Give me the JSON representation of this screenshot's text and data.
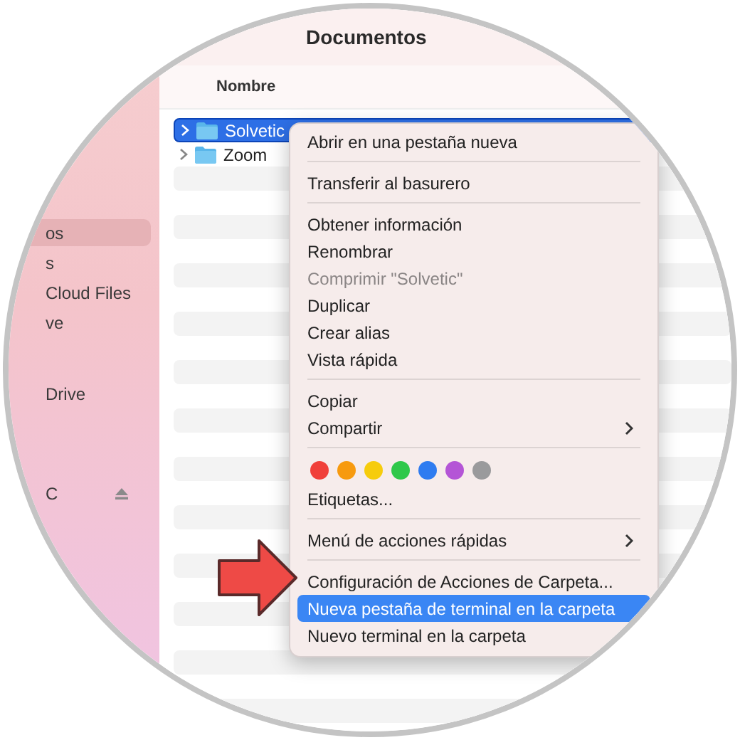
{
  "window": {
    "title": "Documentos"
  },
  "sidebar": {
    "items": [
      {
        "label": "os",
        "selected": true,
        "eject": false
      },
      {
        "label": "s",
        "selected": false,
        "eject": false
      },
      {
        "label": "Cloud Files",
        "selected": false,
        "eject": false
      },
      {
        "label": "ve",
        "selected": false,
        "eject": false
      },
      {
        "label": "Drive",
        "selected": false,
        "eject": false
      },
      {
        "label": "C",
        "selected": false,
        "eject": true
      }
    ]
  },
  "table": {
    "columns": [
      "Nombre"
    ],
    "rows": [
      {
        "name": "Solvetic",
        "selected": true
      },
      {
        "name": "Zoom",
        "selected": false
      }
    ]
  },
  "context_menu": {
    "items": [
      {
        "kind": "item",
        "label": "Abrir en una pestaña nueva",
        "disabled": false,
        "selected": false,
        "submenu": false
      },
      {
        "kind": "separator"
      },
      {
        "kind": "item",
        "label": "Transferir al basurero",
        "disabled": false,
        "selected": false,
        "submenu": false
      },
      {
        "kind": "separator"
      },
      {
        "kind": "item",
        "label": "Obtener información",
        "disabled": false,
        "selected": false,
        "submenu": false
      },
      {
        "kind": "item",
        "label": "Renombrar",
        "disabled": false,
        "selected": false,
        "submenu": false
      },
      {
        "kind": "item",
        "label": "Comprimir \"Solvetic\"",
        "disabled": true,
        "selected": false,
        "submenu": false
      },
      {
        "kind": "item",
        "label": "Duplicar",
        "disabled": false,
        "selected": false,
        "submenu": false
      },
      {
        "kind": "item",
        "label": "Crear alias",
        "disabled": false,
        "selected": false,
        "submenu": false
      },
      {
        "kind": "item",
        "label": "Vista rápida",
        "disabled": false,
        "selected": false,
        "submenu": false
      },
      {
        "kind": "separator"
      },
      {
        "kind": "item",
        "label": "Copiar",
        "disabled": false,
        "selected": false,
        "submenu": false
      },
      {
        "kind": "item",
        "label": "Compartir",
        "disabled": false,
        "selected": false,
        "submenu": true
      },
      {
        "kind": "separator"
      },
      {
        "kind": "tags",
        "colors": [
          {
            "color": "#f0403a"
          },
          {
            "color": "#f79a0e"
          },
          {
            "color": "#f6cc0c"
          },
          {
            "color": "#2fc84a"
          },
          {
            "color": "#2f7cf0"
          },
          {
            "color": "#b455d6"
          },
          {
            "color": "#9a9a9c"
          }
        ]
      },
      {
        "kind": "item",
        "label": "Etiquetas...",
        "disabled": false,
        "selected": false,
        "submenu": false
      },
      {
        "kind": "separator"
      },
      {
        "kind": "item",
        "label": "Menú de acciones rápidas",
        "disabled": false,
        "selected": false,
        "submenu": true
      },
      {
        "kind": "separator"
      },
      {
        "kind": "item",
        "label": "Configuración de Acciones de Carpeta...",
        "disabled": false,
        "selected": false,
        "submenu": false
      },
      {
        "kind": "item",
        "label": "Nueva pestaña de terminal en la carpeta",
        "disabled": false,
        "selected": true,
        "submenu": false
      },
      {
        "kind": "item",
        "label": "Nuevo terminal en la carpeta",
        "disabled": false,
        "selected": false,
        "submenu": false
      }
    ]
  }
}
